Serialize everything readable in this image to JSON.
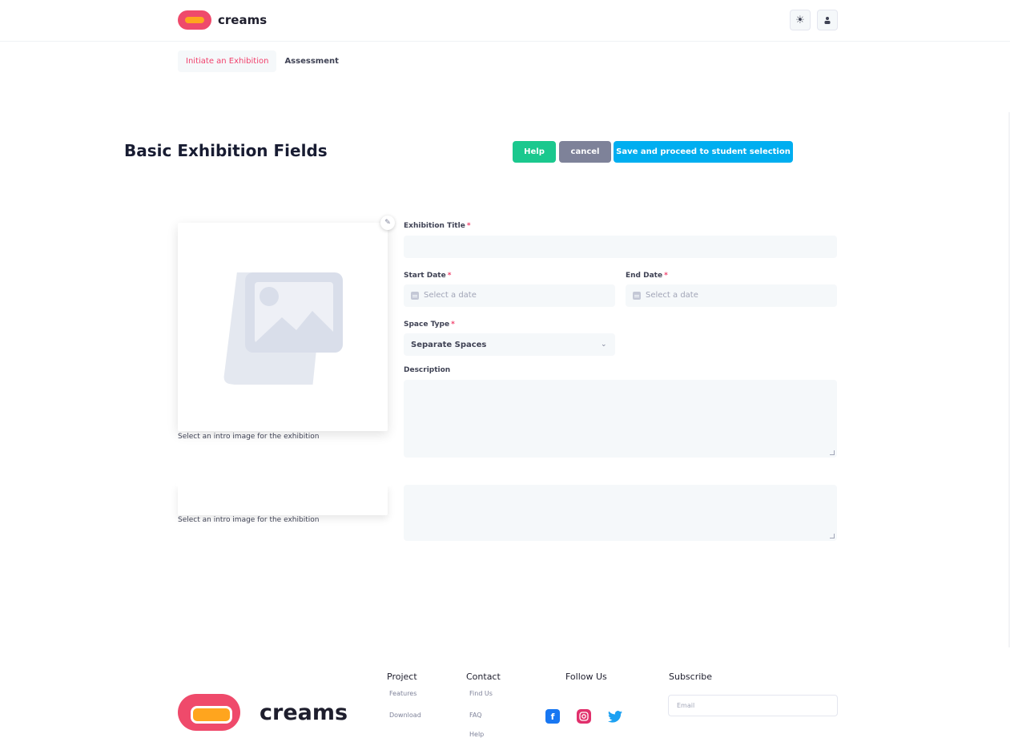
{
  "header": {
    "logo_text": "creams",
    "theme_icon": "sun-icon",
    "user_icon": "user-icon"
  },
  "tabs": [
    {
      "label": "Initiate an Exhibition",
      "active": true
    },
    {
      "label": "Assessment",
      "active": false
    }
  ],
  "page": {
    "title": "Basic Exhibition Fields",
    "help_label": "Help",
    "cancel_label": "cancel",
    "save_label": "Save and proceed to student selection"
  },
  "image": {
    "caption": "Select an intro image for the exhibition",
    "edit_icon": "pencil-icon"
  },
  "form": {
    "title_label": "Exhibition Title",
    "start_label": "Start Date",
    "start_placeholder": "Select a date",
    "end_label": "End Date",
    "end_placeholder": "Select a date",
    "space_label": "Space Type",
    "space_value": "Separate Spaces",
    "description_label": "Description",
    "required_mark": "*"
  },
  "footer": {
    "logo_text": "creams",
    "project_heading": "Project",
    "project_links": [
      "Features",
      "Download"
    ],
    "contact_heading": "Contact",
    "contact_links": [
      "Find Us",
      "FAQ",
      "Help"
    ],
    "follow_heading": "Follow Us",
    "social_icons": [
      "facebook-icon",
      "instagram-icon",
      "twitter-icon"
    ],
    "subscribe_heading": "Subscribe",
    "email_placeholder": "Email"
  },
  "colors": {
    "accent": "#f1416c",
    "help": "#1bc88e",
    "cancel": "#7e8299",
    "save": "#00aef0",
    "logo_pink": "#ef4a6b",
    "logo_orange": "#ffa51e"
  }
}
